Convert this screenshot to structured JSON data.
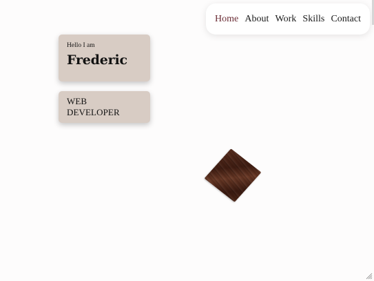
{
  "nav": {
    "items": [
      {
        "label": "Home",
        "active": true
      },
      {
        "label": "About",
        "active": false
      },
      {
        "label": "Work",
        "active": false
      },
      {
        "label": "Skills",
        "active": false
      },
      {
        "label": "Contact",
        "active": false
      }
    ]
  },
  "hero": {
    "greeting": "Hello I am",
    "name": "Frederic",
    "role": "WEB DEVELOPER"
  },
  "colors": {
    "card_background": "#d8ccc4",
    "active_nav": "#6b2d36",
    "page_background": "#fdfcfc"
  },
  "icons": {
    "decoration": "wooden-cube-icon",
    "resize": "resize-grip-icon"
  }
}
